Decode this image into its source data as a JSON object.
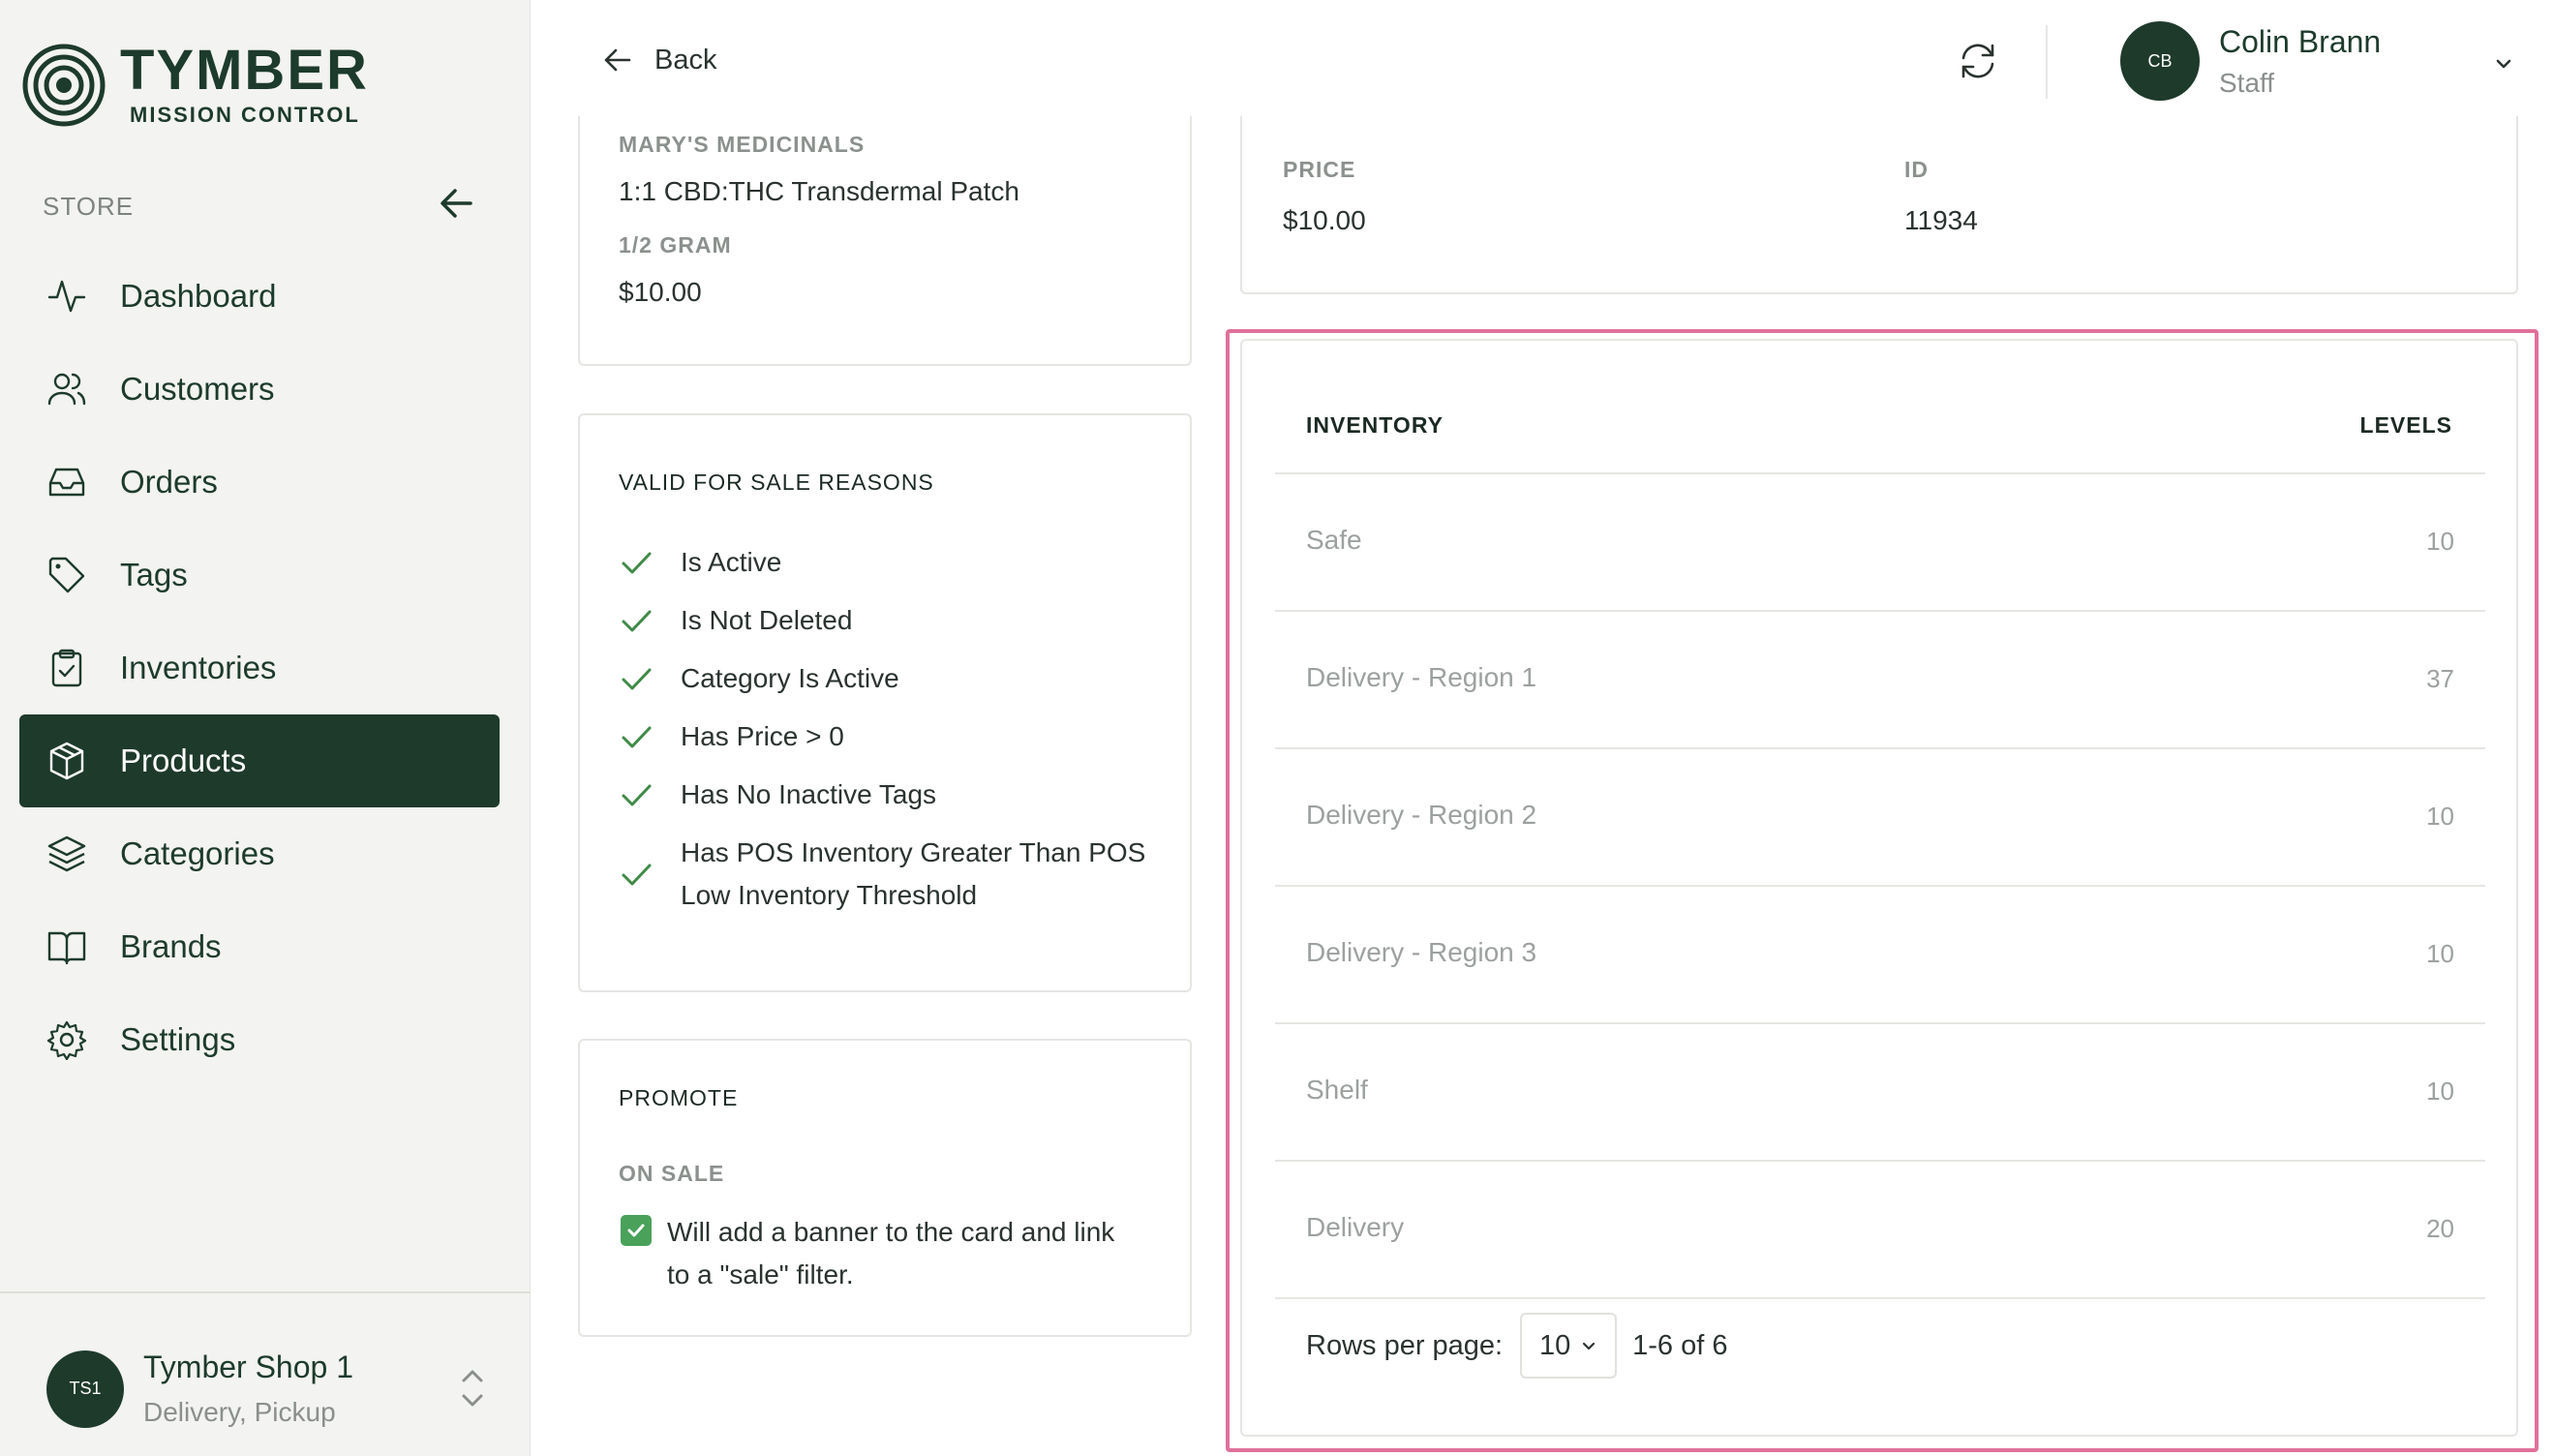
{
  "brand": {
    "title": "TYMBER",
    "subtitle": "MISSION CONTROL"
  },
  "sidebar": {
    "section_label": "STORE",
    "items": [
      {
        "label": "Dashboard",
        "icon": "activity-icon"
      },
      {
        "label": "Customers",
        "icon": "users-icon"
      },
      {
        "label": "Orders",
        "icon": "inbox-icon"
      },
      {
        "label": "Tags",
        "icon": "tag-icon"
      },
      {
        "label": "Inventories",
        "icon": "clipboard-check-icon"
      },
      {
        "label": "Products",
        "icon": "box-icon",
        "active": true
      },
      {
        "label": "Categories",
        "icon": "layers-icon"
      },
      {
        "label": "Brands",
        "icon": "book-open-icon"
      },
      {
        "label": "Settings",
        "icon": "gear-icon"
      }
    ],
    "shop": {
      "initials": "TS1",
      "name": "Tymber Shop 1",
      "modes": "Delivery, Pickup"
    }
  },
  "header": {
    "back_label": "Back",
    "user": {
      "initials": "CB",
      "name": "Colin Brann",
      "role": "Staff"
    }
  },
  "product": {
    "brand": "MARY'S MEDICINALS",
    "name": "1:1 CBD:THC Transdermal Patch",
    "size": "1/2 GRAM",
    "price": "$10.00"
  },
  "valid_for_sale": {
    "title": "VALID FOR SALE REASONS",
    "reasons": [
      "Is Active",
      "Is Not Deleted",
      "Category Is Active",
      "Has Price > 0",
      "Has No Inactive Tags",
      "Has POS Inventory Greater Than POS",
      "Low Inventory Threshold"
    ]
  },
  "promote": {
    "title": "PROMOTE",
    "on_sale_label": "ON SALE",
    "on_sale_checked": true,
    "on_sale_text_1": "Will add a banner to the card and link",
    "on_sale_text_2": "to a \"sale\" filter."
  },
  "price_card": {
    "price_label": "PRICE",
    "price_value": "$10.00",
    "id_label": "ID",
    "id_value": "11934"
  },
  "inventory": {
    "col_inventory": "INVENTORY",
    "col_levels": "LEVELS",
    "rows": [
      {
        "name": "Safe",
        "level": "10"
      },
      {
        "name": "Delivery - Region 1",
        "level": "37"
      },
      {
        "name": "Delivery - Region 2",
        "level": "10"
      },
      {
        "name": "Delivery - Region 3",
        "level": "10"
      },
      {
        "name": "Shelf",
        "level": "10"
      },
      {
        "name": "Delivery",
        "level": "20"
      }
    ],
    "pager": {
      "rows_per_page_label": "Rows per page:",
      "rows_per_page": "10",
      "range": "1-6 of 6"
    }
  },
  "colors": {
    "brand_green": "#1e3a2b",
    "check_green": "#3f8a47",
    "highlight": "#e0709a"
  }
}
